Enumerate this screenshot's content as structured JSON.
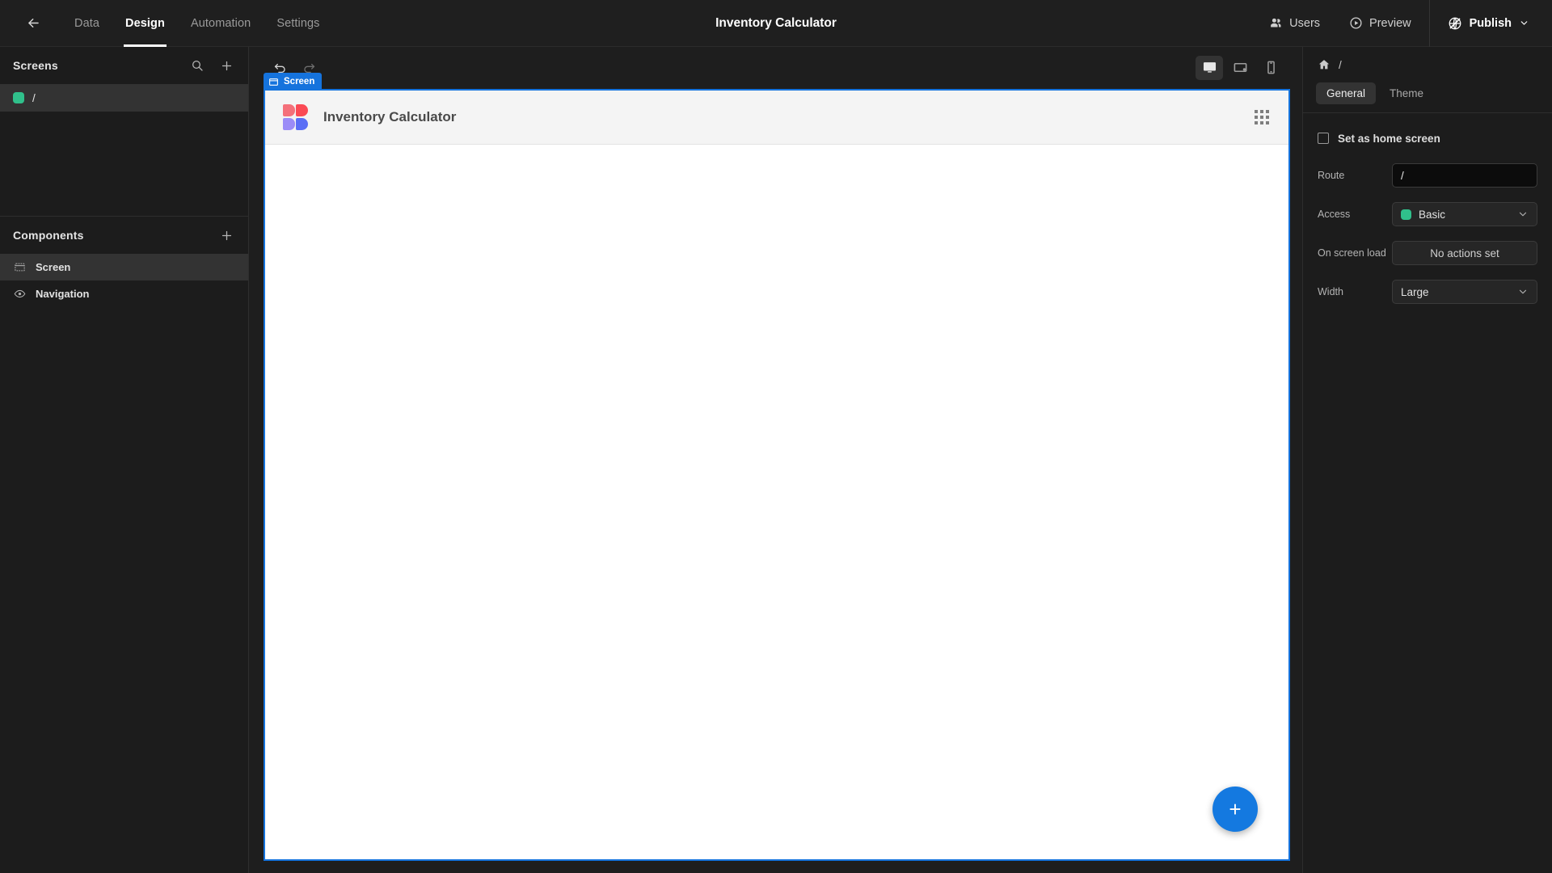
{
  "topbar": {
    "back_icon": "arrow-left-icon",
    "tabs": [
      {
        "label": "Data",
        "active": false
      },
      {
        "label": "Design",
        "active": true
      },
      {
        "label": "Automation",
        "active": false
      },
      {
        "label": "Settings",
        "active": false
      }
    ],
    "title": "Inventory Calculator",
    "users_label": "Users",
    "preview_label": "Preview",
    "publish_label": "Publish"
  },
  "left_panel": {
    "screens": {
      "title": "Screens",
      "search_icon": "search-icon",
      "add_icon": "plus-icon",
      "items": [
        {
          "route": "/",
          "access_color": "#30c08b",
          "selected": true
        }
      ]
    },
    "components": {
      "title": "Components",
      "add_icon": "plus-icon",
      "items": [
        {
          "label": "Screen",
          "icon": "screen-icon",
          "selected": true
        },
        {
          "label": "Navigation",
          "icon": "eye-icon",
          "selected": false
        }
      ]
    }
  },
  "canvas": {
    "undo_icon": "undo-icon",
    "redo_icon": "redo-icon",
    "devices": [
      {
        "name": "desktop",
        "active": true
      },
      {
        "name": "tablet",
        "active": false
      },
      {
        "name": "mobile",
        "active": false
      }
    ],
    "selection_badge": "Screen",
    "selection_color": "#1573dd",
    "app_header": {
      "app_name": "Inventory Calculator",
      "logo_colors": {
        "top_left": "#f4707a",
        "top_right": "#fb4a55",
        "bottom_left": "#9b8cf7",
        "bottom_right": "#5b6ef5"
      },
      "menu_icon": "grid-dots-icon"
    },
    "fab": {
      "icon": "plus-icon",
      "label": "+",
      "color": "#1479e0"
    }
  },
  "right_panel": {
    "breadcrumb": {
      "home_icon": "home-icon",
      "path": "/"
    },
    "tabs": [
      {
        "label": "General",
        "active": true
      },
      {
        "label": "Theme",
        "active": false
      }
    ],
    "home_screen_checkbox": {
      "label": "Set as home screen",
      "checked": false
    },
    "fields": [
      {
        "label": "Route",
        "type": "input",
        "value": "/"
      },
      {
        "label": "Access",
        "type": "select",
        "value": "Basic",
        "dot_color": "#30c08b"
      },
      {
        "label": "On screen load",
        "type": "button",
        "value": "No actions set"
      },
      {
        "label": "Width",
        "type": "select",
        "value": "Large"
      }
    ]
  }
}
